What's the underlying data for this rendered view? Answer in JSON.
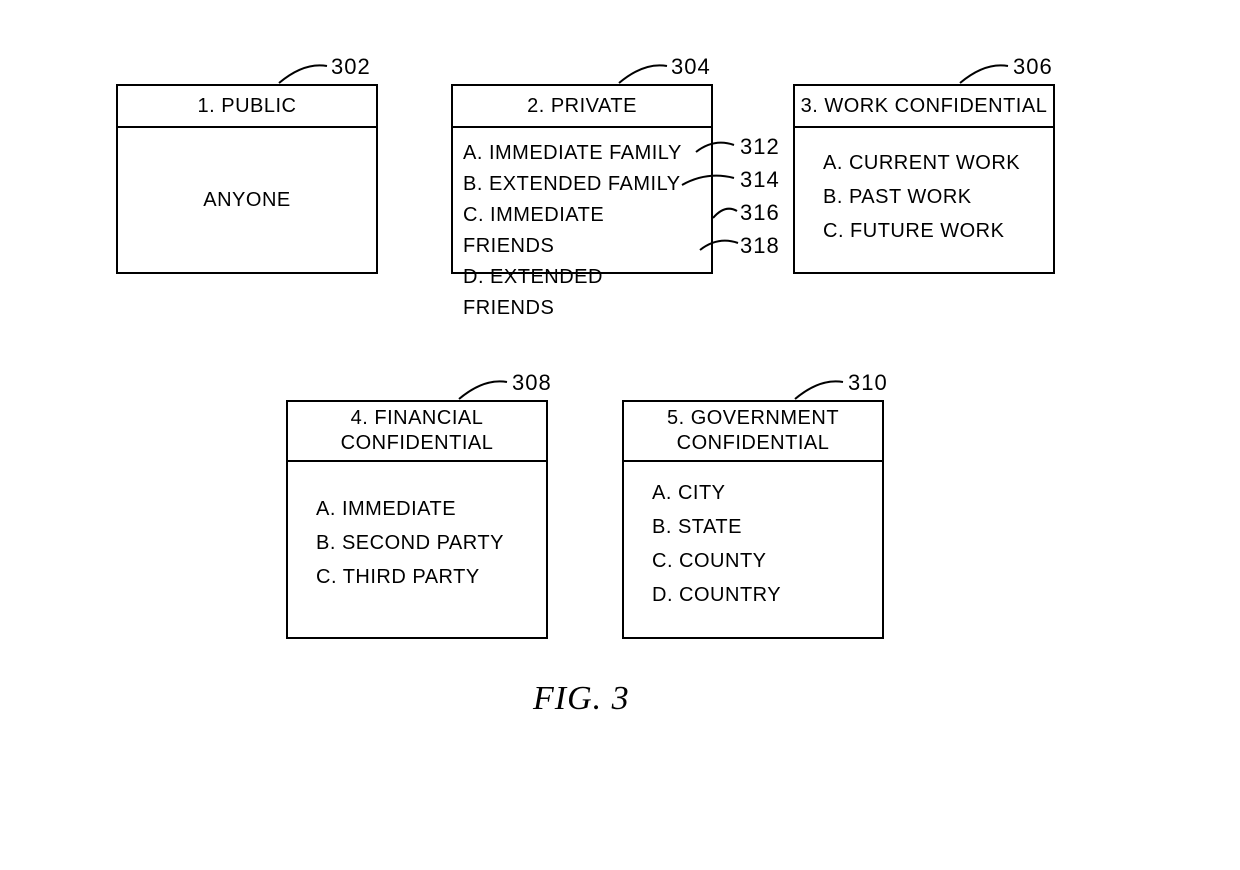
{
  "figure_caption": "FIG. 3",
  "boxes": {
    "public": {
      "ref": "302",
      "title": "1. PUBLIC",
      "body_text": "ANYONE"
    },
    "private": {
      "ref": "304",
      "title": "2. PRIVATE",
      "items": [
        "A. IMMEDIATE FAMILY",
        "B. EXTENDED FAMILY",
        "C. IMMEDIATE FRIENDS",
        "D. EXTENDED FRIENDS"
      ],
      "item_refs": [
        "312",
        "314",
        "316",
        "318"
      ]
    },
    "work": {
      "ref": "306",
      "title": "3. WORK CONFIDENTIAL",
      "items": [
        "A. CURRENT WORK",
        "B. PAST WORK",
        "C. FUTURE WORK"
      ]
    },
    "financial": {
      "ref": "308",
      "title": "4. FINANCIAL CONFIDENTIAL",
      "items": [
        "A. IMMEDIATE",
        "B. SECOND PARTY",
        "C. THIRD PARTY"
      ]
    },
    "government": {
      "ref": "310",
      "title": "5. GOVERNMENT CONFIDENTIAL",
      "items": [
        "A. CITY",
        "B. STATE",
        "C. COUNTY",
        "D. COUNTRY"
      ]
    }
  }
}
